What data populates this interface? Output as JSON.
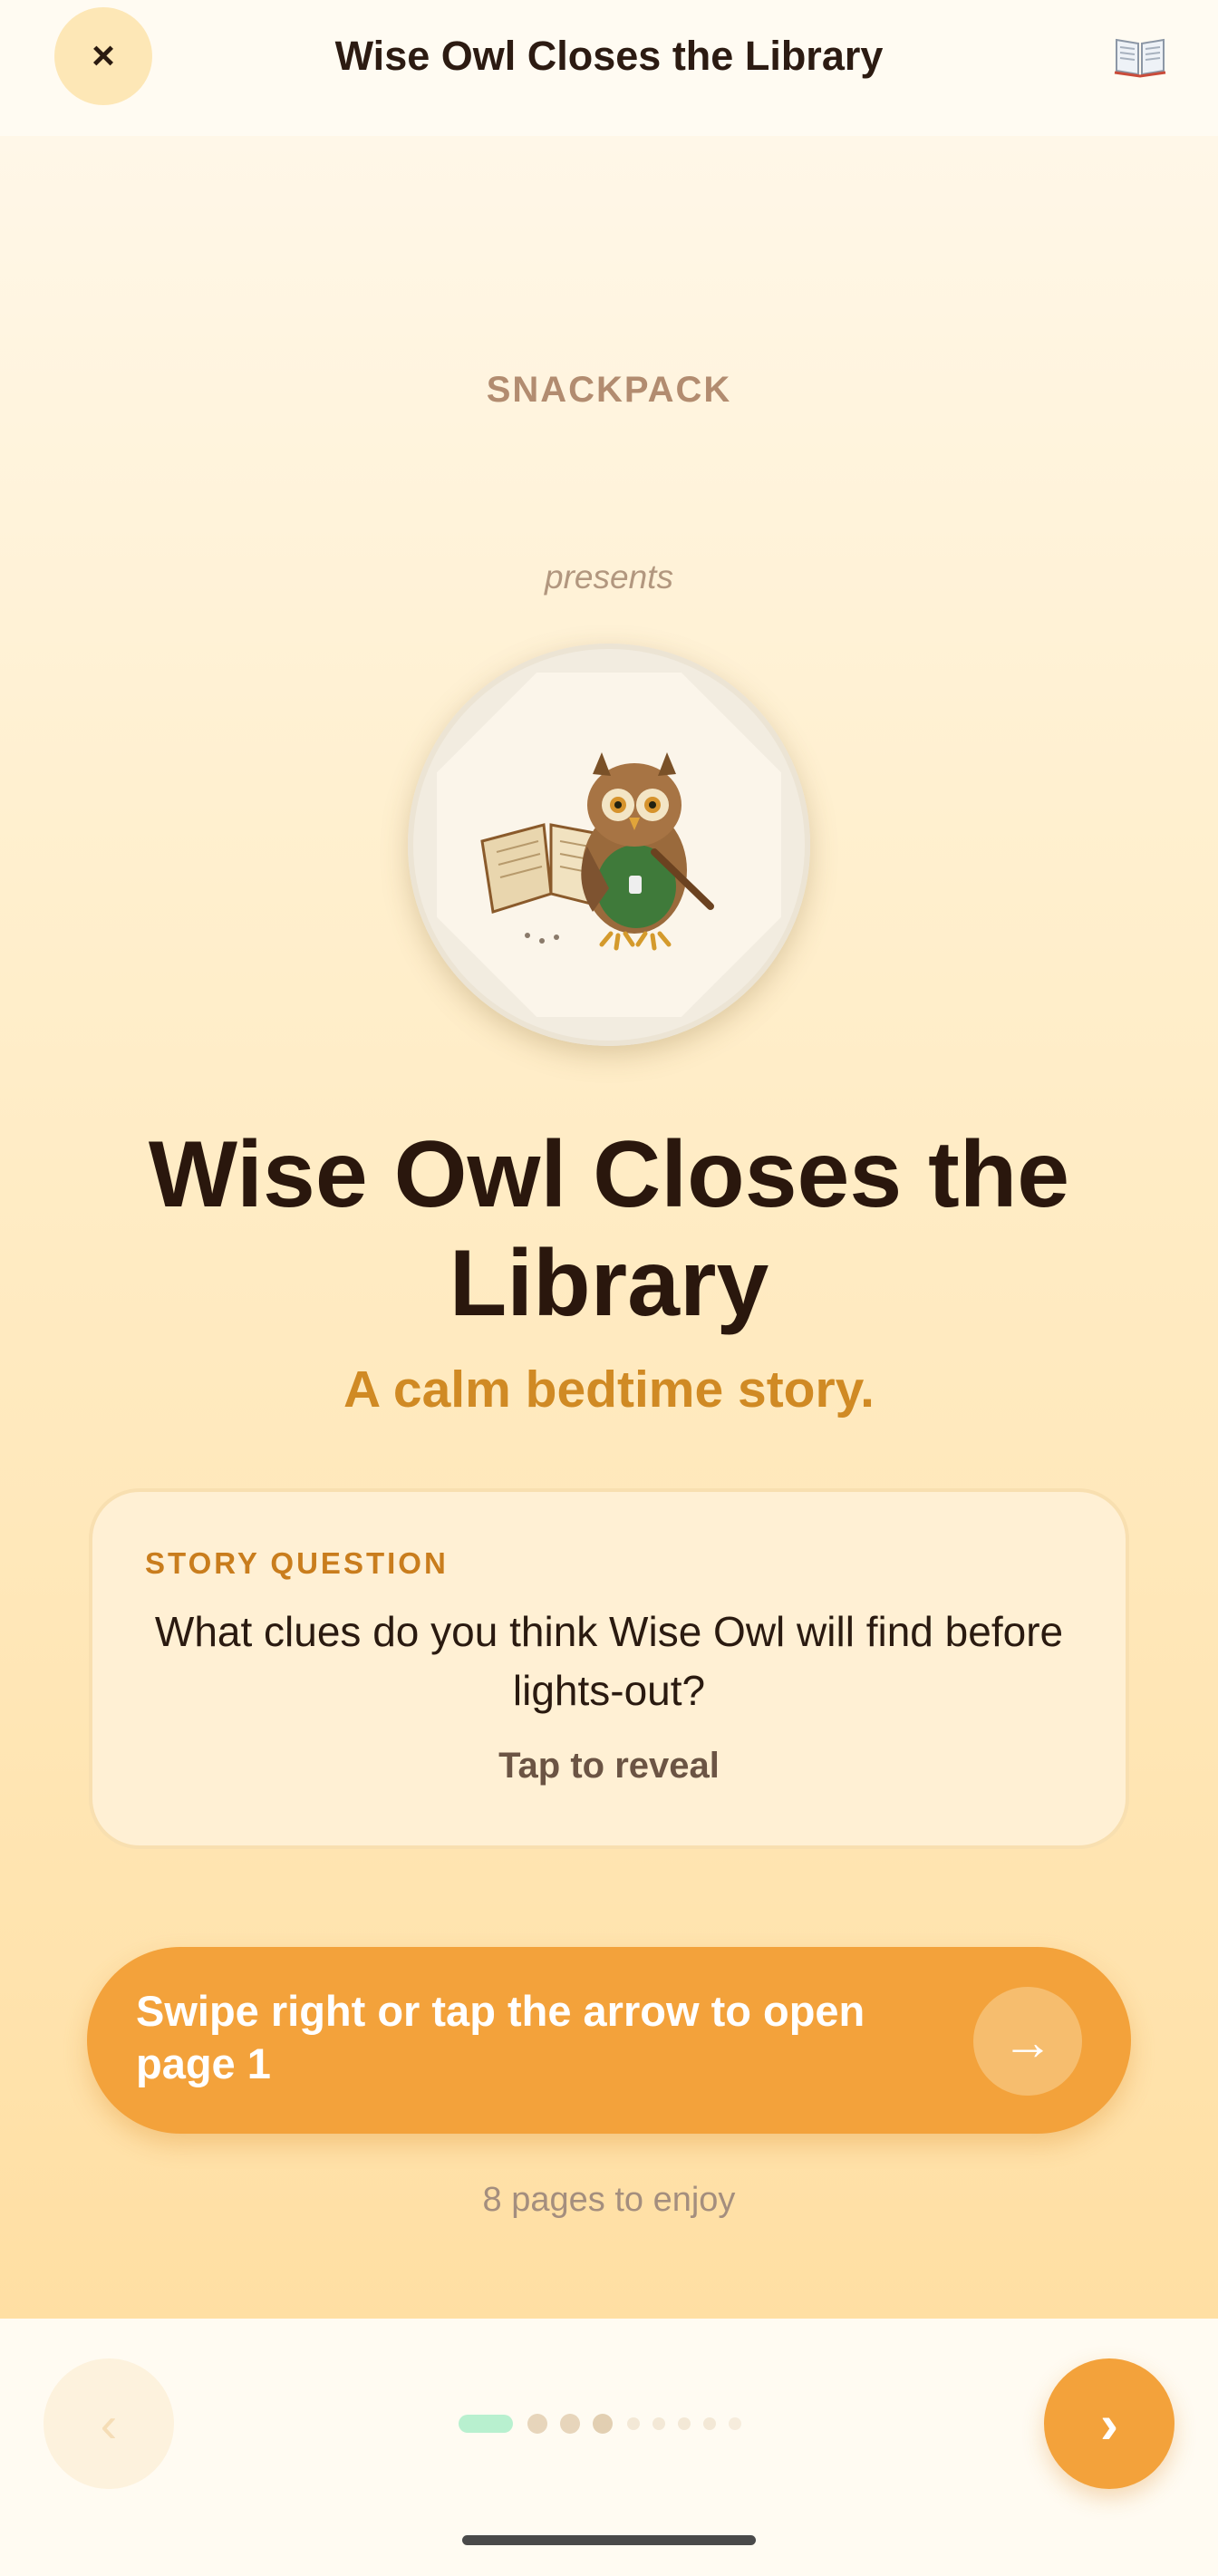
{
  "header": {
    "title": "Wise Owl Closes the Library",
    "close_label": "×",
    "close_icon": "close-icon",
    "book_icon": "open-book-icon"
  },
  "cover": {
    "brand": "SNACKPACK",
    "presents": "presents",
    "illustration": "owl-with-book-illustration",
    "title": "Wise Owl Closes the Library",
    "subtitle": "A calm bedtime story."
  },
  "question_card": {
    "label": "STORY QUESTION",
    "question": "What clues do you think Wise Owl will find before lights-out?",
    "reveal_label": "Tap to reveal"
  },
  "cta": {
    "label": "Swipe right or tap the arrow to open page 1",
    "arrow": "→",
    "arrow_icon": "arrow-right-icon"
  },
  "pages_info": "8 pages to enjoy",
  "navigation": {
    "prev_label": "‹",
    "next_label": "›",
    "prev_icon": "chevron-left-icon",
    "next_icon": "chevron-right-icon",
    "current_index": 0,
    "total_dots": 9
  },
  "colors": {
    "accent": "#f3a23b",
    "accent_text": "#d08a24",
    "title_text": "#2a170d",
    "active_dot": "#b8f0cf",
    "card_bg": "#fff0d4"
  }
}
